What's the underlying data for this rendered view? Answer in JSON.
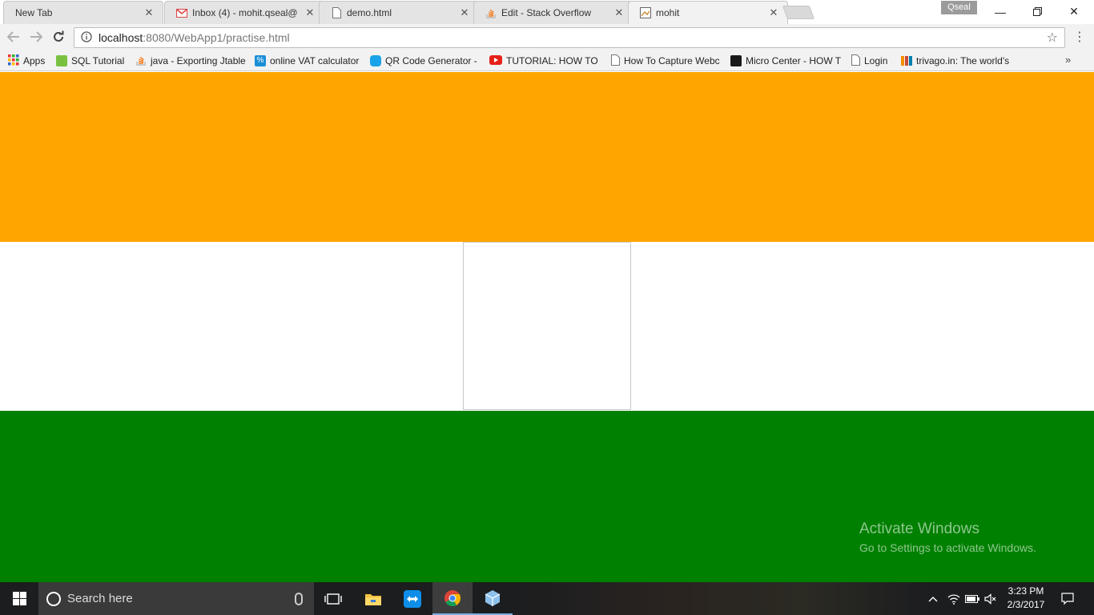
{
  "browser": {
    "tabs": [
      {
        "title": "New Tab",
        "icon": "none",
        "active": false
      },
      {
        "title": "Inbox (4) - mohit.qseal@",
        "icon": "gmail-icon",
        "active": false
      },
      {
        "title": "demo.html",
        "icon": "page-icon",
        "active": false
      },
      {
        "title": "Edit - Stack Overflow",
        "icon": "stackoverflow-icon",
        "active": false
      },
      {
        "title": "mohit",
        "icon": "image-icon",
        "active": true
      }
    ],
    "profile": "Qseal",
    "url_host": "localhost",
    "url_rest": ":8080/WebApp1/practise.html",
    "bookmarks": [
      {
        "label": "Apps",
        "icon": "apps-grid-icon"
      },
      {
        "label": "SQL Tutorial",
        "icon": "w3schools-icon"
      },
      {
        "label": "java - Exporting Jtable",
        "icon": "stackoverflow-icon"
      },
      {
        "label": "online VAT calculator",
        "icon": "percent-icon"
      },
      {
        "label": "QR Code Generator -",
        "icon": "qr-icon"
      },
      {
        "label": "TUTORIAL: HOW TO IN",
        "icon": "youtube-icon"
      },
      {
        "label": "How To Capture Webc",
        "icon": "page-icon"
      },
      {
        "label": "Micro Center - HOW T",
        "icon": "microcenter-icon"
      },
      {
        "label": "Login",
        "icon": "page-icon"
      },
      {
        "label": "trivago.in: The world's",
        "icon": "trivago-icon"
      }
    ],
    "bookmarks_more": "»"
  },
  "page": {
    "colors": {
      "saffron": "#FFA500",
      "white": "#FFFFFF",
      "green": "#008000"
    }
  },
  "watermark": {
    "title": "Activate Windows",
    "subtitle": "Go to Settings to activate Windows."
  },
  "taskbar": {
    "search_placeholder": "Search here",
    "time": "3:23 PM",
    "date": "2/3/2017"
  }
}
